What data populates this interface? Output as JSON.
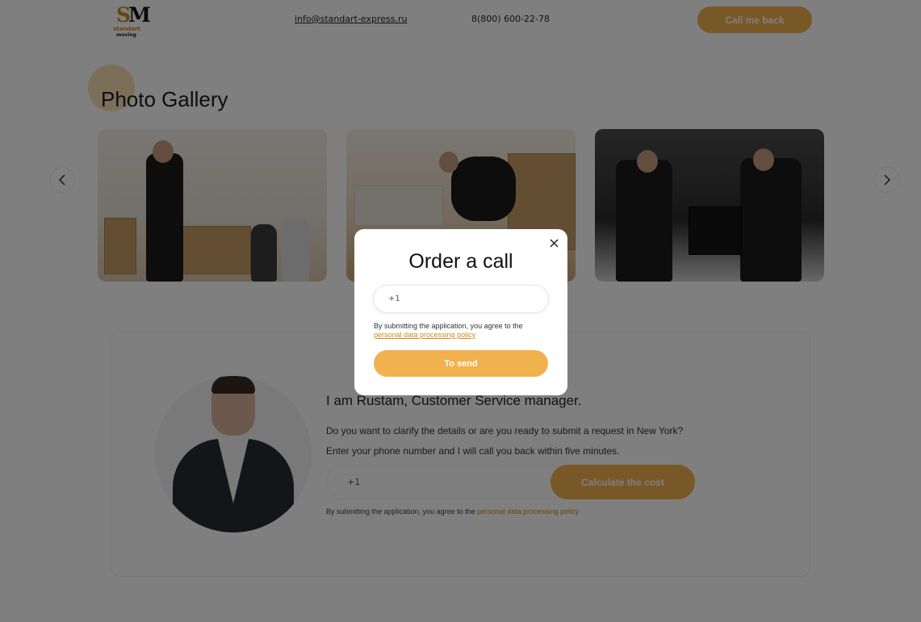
{
  "header": {
    "logo_letters_1": "S",
    "logo_letters_2": "M",
    "logo_word_1": "standart",
    "logo_word_2": "moving",
    "email": "info@standart-express.ru",
    "phone": "8(800) 600-22-78",
    "callback_label": "Call me back"
  },
  "gallery": {
    "title": "Photo Gallery",
    "prev_icon": "chevron-left-icon",
    "next_icon": "chevron-right-icon"
  },
  "manager": {
    "title": "I am Rustam, Customer Service manager.",
    "line1": "Do you want to clarify the details or are you ready to submit a request in New York?",
    "line2": "Enter your phone number and I will call you back within five minutes.",
    "phone_placeholder": "+1",
    "button_label": "Calculate the cost",
    "consent_text": "By submitting the application, you agree to the ",
    "consent_link": "personal data processing policy"
  },
  "modal": {
    "title": "Order a call",
    "close_icon": "close-icon",
    "phone_value": "+1",
    "consent_text": "By submitting the application, you agree to the",
    "consent_link": "personal data processing policy",
    "send_label": "To send"
  },
  "colors": {
    "accent": "#f2b14f",
    "link": "#c98b1e",
    "overlay": "rgba(0,0,0,0.5)"
  }
}
